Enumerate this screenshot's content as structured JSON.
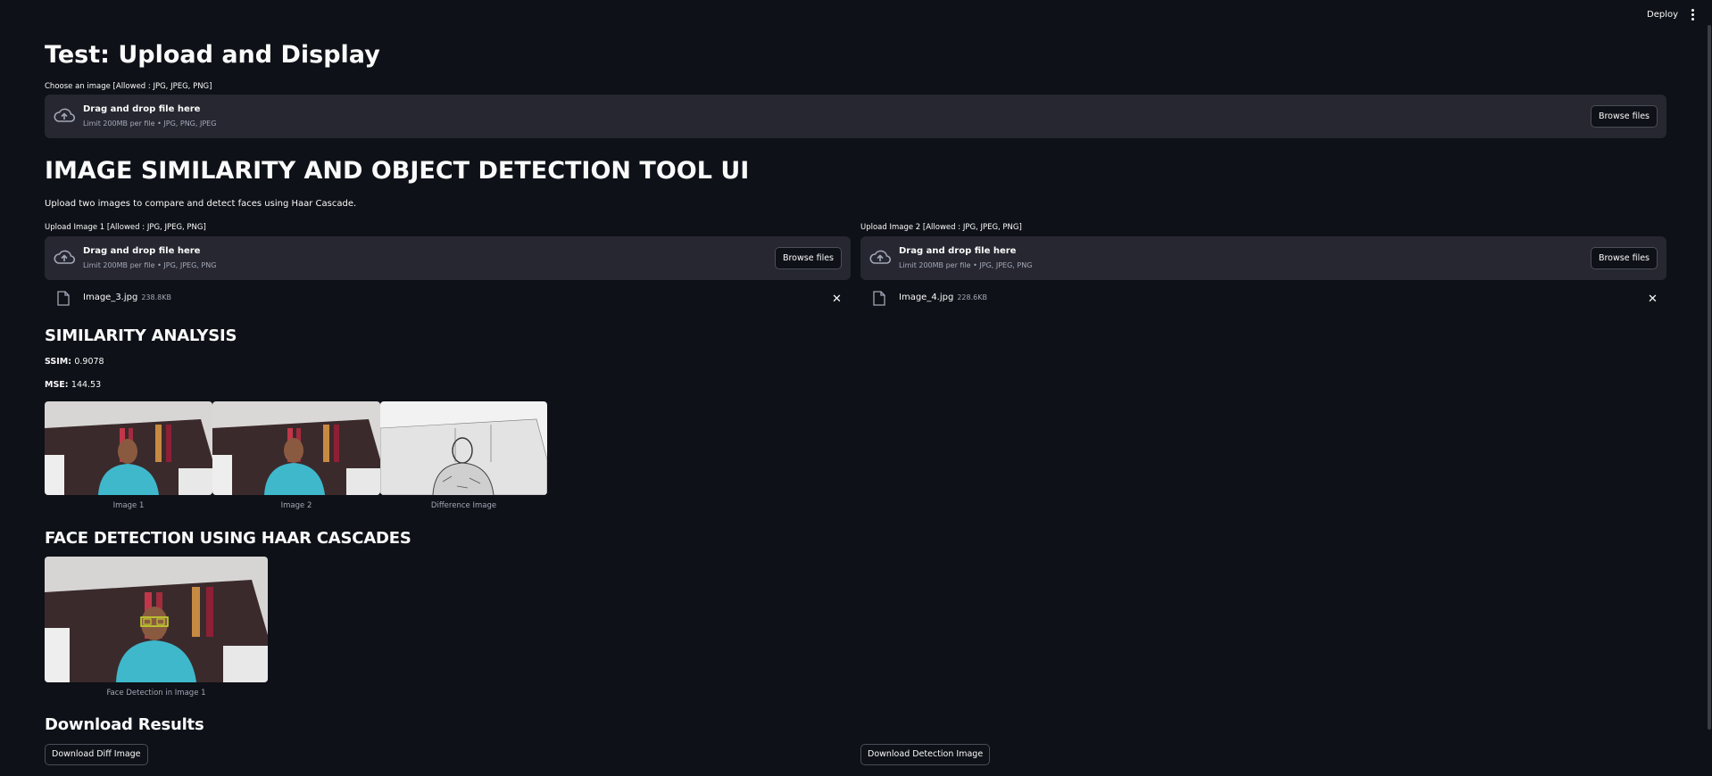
{
  "header": {
    "deploy_label": "Deploy",
    "menu_icon": "kebab-menu-icon"
  },
  "page": {
    "title": "Test: Upload and Display",
    "upload_label": "Choose an image [Allowed : JPG, JPEG, PNG]"
  },
  "uploader_main": {
    "drop_text": "Drag and drop file here",
    "limit_text": "Limit 200MB per file • JPG, PNG, JPEG",
    "browse_label": "Browse files"
  },
  "tool": {
    "title": "IMAGE SIMILARITY AND OBJECT DETECTION TOOL UI",
    "description": "Upload two images to compare and detect faces using Haar Cascade."
  },
  "uploader1": {
    "label": "Upload Image 1 [Allowed : JPG, JPEG, PNG]",
    "drop_text": "Drag and drop file here",
    "limit_text": "Limit 200MB per file • JPG, JPEG, PNG",
    "browse_label": "Browse files",
    "file_name": "Image_3.jpg",
    "file_size": "238.8KB"
  },
  "uploader2": {
    "label": "Upload Image 2 [Allowed : JPG, JPEG, PNG]",
    "drop_text": "Drag and drop file here",
    "limit_text": "Limit 200MB per file • JPG, JPEG, PNG",
    "browse_label": "Browse files",
    "file_name": "Image_4.jpg",
    "file_size": "228.6KB"
  },
  "similarity": {
    "heading": "SIMILARITY ANALYSIS",
    "ssim_label": "SSIM:",
    "ssim_value": "0.9078",
    "mse_label": "MSE:",
    "mse_value": "144.53",
    "captions": [
      "Image 1",
      "Image 2",
      "Difference Image"
    ]
  },
  "face_detection": {
    "heading": "FACE DETECTION USING HAAR CASCADES",
    "caption": "Face Detection in Image 1"
  },
  "downloads": {
    "heading": "Download Results",
    "diff_label": "Download Diff Image",
    "detection_label": "Download Detection Image"
  },
  "colors": {
    "background": "#0e1117",
    "panel": "#262730",
    "text": "#fafafa",
    "muted": "#a3a8b8",
    "shirt": "#3fb8cc",
    "face_box": "#c8e02a"
  }
}
